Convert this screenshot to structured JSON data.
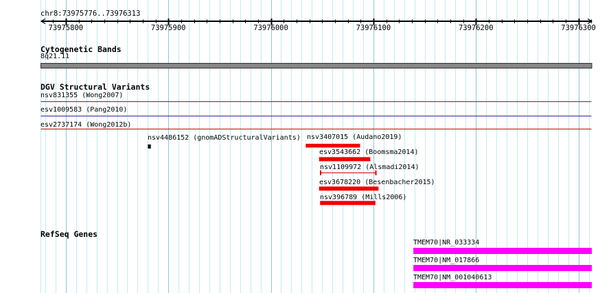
{
  "header": {
    "region_label": "chr8:73975776..73976313"
  },
  "ruler": {
    "start": 73975776,
    "end": 73976313,
    "major_ticks": [
      {
        "value": 73975800,
        "label": "73975800"
      },
      {
        "value": 73975900,
        "label": "73975900"
      },
      {
        "value": 73976000,
        "label": "73976000"
      },
      {
        "value": 73976100,
        "label": "73976100"
      },
      {
        "value": 73976200,
        "label": "73976200"
      },
      {
        "value": 73976300,
        "label": "73976300"
      }
    ],
    "minor_tick_step_bp": 12.5,
    "grid_minor_step_bp": 10,
    "grid_major_step_bp": 100
  },
  "colors": {
    "background": "#ffffff",
    "grid_minor": "#c4ebf1",
    "grid_major": "#8cc6e2",
    "ruler": "#000000",
    "text": "#000000",
    "band_fill": "#878787",
    "band_border": "#2f2f2f",
    "red_line": "#cc0000",
    "red_box": "#ee0000",
    "purple_line": "#3d1a9e",
    "point_black": "#1a1a1a",
    "gene_magenta": "#ff00ff"
  },
  "tracks": [
    {
      "title": "Cytogenetic Bands",
      "features": [
        {
          "label": "8q21.11",
          "type": "band",
          "start": 73975776,
          "end": 73976313,
          "color_key": "band_fill"
        }
      ]
    },
    {
      "title": "DGV Structural Variants",
      "features": [
        {
          "label": "nsv831355 (Wong2007)",
          "type": "hline",
          "start": 73975776,
          "end": 73976313,
          "color_key": "red_line"
        },
        {
          "label": "esv1009583 (Pang2010)",
          "type": "hline",
          "start": 73975776,
          "end": 73976313,
          "color_key": "purple_line"
        },
        {
          "label": "esv2737174 (Wong2012b)",
          "type": "hline",
          "start": 73975776,
          "end": 73976313,
          "color_key": "red_line"
        },
        {
          "label": "nsv4486152 (gnomADStructuralVariants)",
          "type": "point",
          "start": 73975880,
          "end": 73975883,
          "color_key": "point_black"
        },
        {
          "label": "nsv3407015 (Audano2019)",
          "type": "box",
          "start": 73976034,
          "end": 73976087,
          "color_key": "red_box"
        },
        {
          "label": "esv3543662 (Boomsma2014)",
          "type": "box",
          "start": 73976047,
          "end": 73976097,
          "color_key": "red_box"
        },
        {
          "label": "nsv1109972 (Alsmadi2014)",
          "type": "ibeam",
          "start": 73976048,
          "end": 73976103,
          "color_key": "red_line"
        },
        {
          "label": "esv3678220 (Besenbacher2015)",
          "type": "box",
          "start": 73976047,
          "end": 73976105,
          "color_key": "red_box"
        },
        {
          "label": "nsv396789 (Mills2006)",
          "type": "box",
          "start": 73976048,
          "end": 73976102,
          "color_key": "red_box"
        }
      ]
    },
    {
      "title": "RefSeq Genes",
      "features": [
        {
          "label": "TMEM70|NR_033334",
          "type": "gene",
          "start": 73976139,
          "end": 73976313,
          "color_key": "gene_magenta"
        },
        {
          "label": "TMEM70|NM_017866",
          "type": "gene",
          "start": 73976139,
          "end": 73976313,
          "color_key": "gene_magenta"
        },
        {
          "label": "TMEM70|NM_001040613",
          "type": "gene",
          "start": 73976139,
          "end": 73976313,
          "color_key": "gene_magenta"
        }
      ]
    }
  ]
}
